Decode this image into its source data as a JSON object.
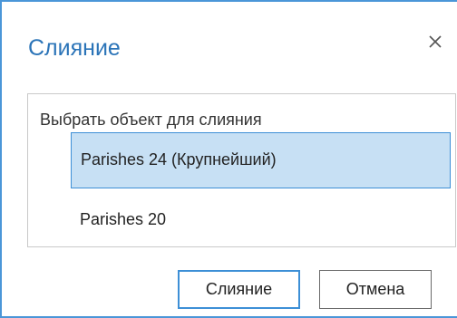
{
  "dialog": {
    "title": "Слияние",
    "close_icon": "close-icon"
  },
  "panel": {
    "label": "Выбрать объект для слияния",
    "items": [
      {
        "label": "Parishes 24 (Крупнейший)",
        "selected": true
      },
      {
        "label": "Parishes 20",
        "selected": false
      }
    ]
  },
  "buttons": {
    "merge_label": "Слияние",
    "cancel_label": "Отмена"
  },
  "colors": {
    "accent": "#2b74b8",
    "selection_fill": "#c7e0f4",
    "selection_border": "#3d8fd6"
  }
}
